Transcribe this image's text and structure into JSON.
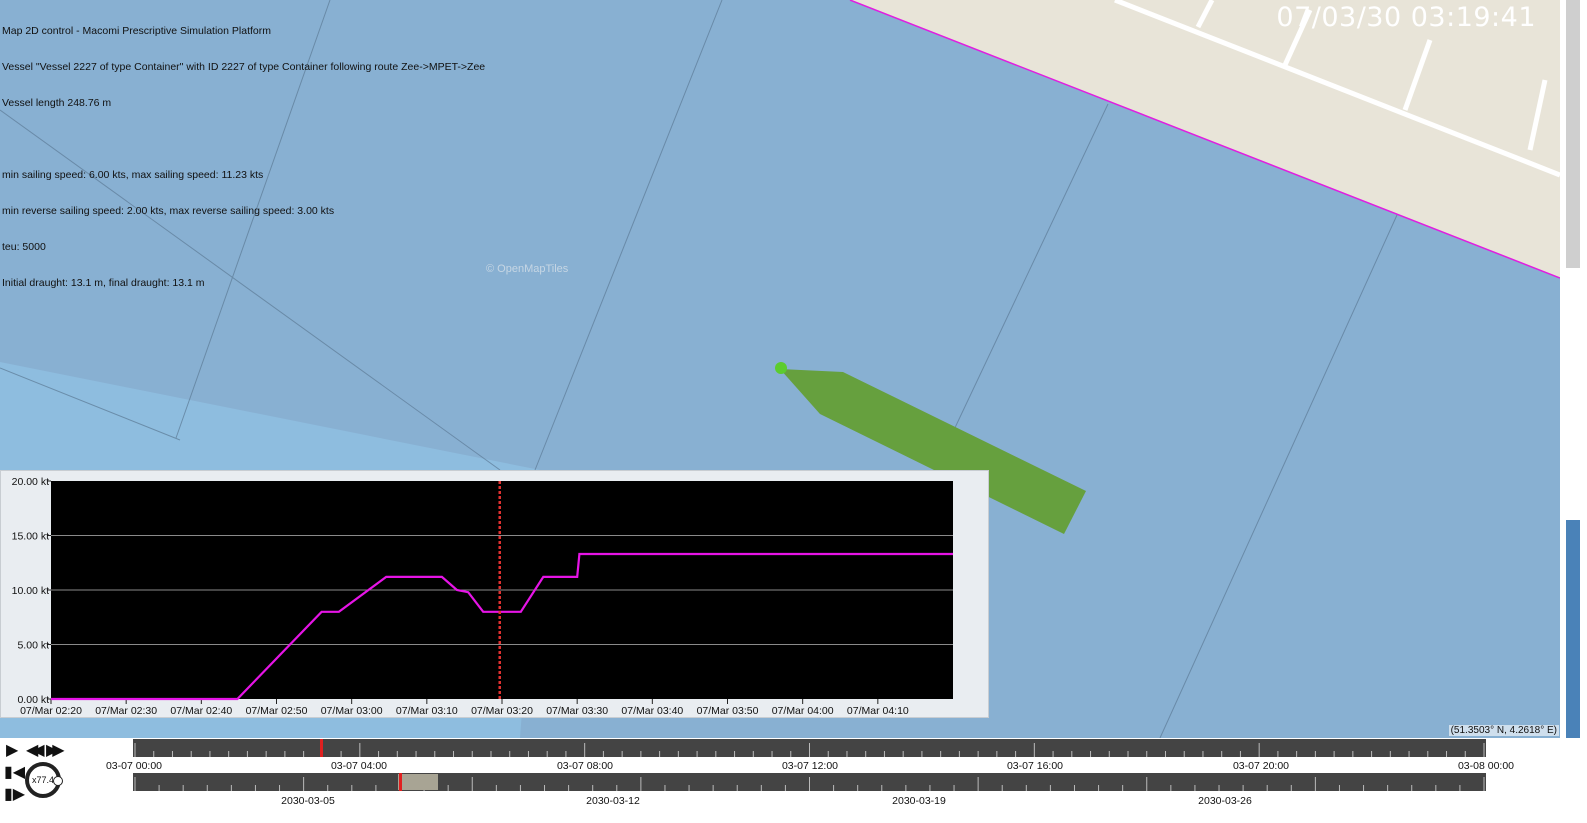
{
  "window": {
    "title": "Map 2D control - Macomi Prescriptive Simulation Platform"
  },
  "vessel_info": [
    "Map 2D control - Macomi Prescriptive Simulation Platform",
    "Vessel \"Vessel 2227 of type Container\" with ID 2227 of type Container following route Zee->MPET->Zee",
    "Vessel length 248.76 m",
    "",
    "min sailing speed: 6.00 kts, max sailing speed: 11.23 kts",
    "min reverse sailing speed: 2.00 kts, max reverse sailing speed: 3.00 kts",
    "teu: 5000",
    "Initial draught: 13.1 m, final draught: 13.1 m"
  ],
  "clock": "07/03/30 03:19:41",
  "attribution": "© OpenMapTiles",
  "coordinates": "(51.3503° N, 4.2618° E)",
  "colors": {
    "water": "#88b0d2",
    "land": "#e8e4d8",
    "vessel": "#66a03e",
    "route_line": "#e01ee0",
    "chart_bg": "#000000",
    "speed_line": "#e614e6",
    "current_time_marker": "#e03030"
  },
  "chart_data": {
    "type": "line",
    "y_ticks": [
      "0.00 kt",
      "5.00 kt",
      "10.00 kt",
      "15.00 kt",
      "20.00 kt"
    ],
    "y_tick_values": [
      0,
      5,
      10,
      15,
      20
    ],
    "ylim": [
      0,
      20
    ],
    "x_ticks": [
      "07/Mar 02:20",
      "07/Mar 02:30",
      "07/Mar 02:40",
      "07/Mar 02:50",
      "07/Mar 03:00",
      "07/Mar 03:10",
      "07/Mar 03:20",
      "07/Mar 03:30",
      "07/Mar 03:40",
      "07/Mar 03:50",
      "07/Mar 04:00",
      "07/Mar 04:10"
    ],
    "x_tick_minutes": [
      140,
      150,
      160,
      170,
      180,
      190,
      200,
      210,
      220,
      230,
      240,
      250
    ],
    "xlim": [
      140,
      260
    ],
    "current_time": 199.7,
    "grid": true,
    "series": [
      {
        "x": [
          140,
          164.8,
          176,
          178.3,
          184.6,
          192,
          194,
          195.5,
          197.5,
          202.5,
          205.5,
          210,
          210.3,
          260
        ],
        "y": [
          0,
          0,
          8,
          8,
          11.2,
          11.2,
          10,
          9.8,
          8,
          8,
          11.2,
          11.2,
          13.3,
          13.3
        ]
      }
    ]
  },
  "timeline": {
    "top_labels": [
      "03-07 00:00",
      "03-07 04:00",
      "03-07 08:00",
      "03-07 12:00",
      "03-07 16:00",
      "03-07 20:00",
      "03-08 00:00"
    ],
    "bottom_labels": [
      "2030-03-05",
      "2030-03-12",
      "2030-03-19",
      "2030-03-26"
    ],
    "speed": "x77.4"
  },
  "icons": {
    "play": "play-icon",
    "rewind": "rewind-icon",
    "fast_forward": "fast-forward-icon",
    "step_back": "step-back-icon",
    "step_forward": "step-forward-icon"
  }
}
